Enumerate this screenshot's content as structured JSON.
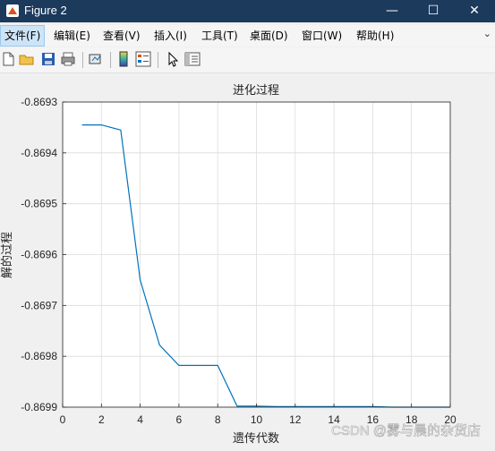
{
  "window": {
    "title": "Figure 2",
    "minimize": "—",
    "maximize": "☐",
    "close": "✕"
  },
  "menu": [
    "文件(F)",
    "编辑(E)",
    "查看(V)",
    "插入(I)",
    "工具(T)",
    "桌面(D)",
    "窗口(W)",
    "帮助(H)"
  ],
  "toolbar_icons": [
    "new-figure-icon",
    "open-file-icon",
    "save-icon",
    "print-icon",
    "link-plot-icon",
    "colorbar-icon",
    "legend-icon",
    "edit-plot-arrow-icon",
    "property-inspector-icon"
  ],
  "watermark": "CSDN @雾与晨的杂货店",
  "chart_data": {
    "type": "line",
    "title": "进化过程",
    "xlabel": "遗传代数",
    "ylabel": "解的过程",
    "xlim": [
      0,
      20
    ],
    "ylim": [
      -0.8699,
      -0.8693
    ],
    "xticks": [
      0,
      2,
      4,
      6,
      8,
      10,
      12,
      14,
      16,
      18,
      20
    ],
    "yticks": [
      -0.8693,
      -0.8694,
      -0.8695,
      -0.8696,
      -0.8697,
      -0.8698,
      -0.8699
    ],
    "ytick_labels": [
      "-0.8693",
      "-0.8694",
      "-0.8695",
      "-0.8696",
      "-0.8697",
      "-0.8698",
      "-0.8699"
    ],
    "grid": true,
    "line_color": "#0072bd",
    "series": [
      {
        "x": [
          1,
          2,
          3,
          4,
          5,
          6,
          7,
          8,
          9,
          10,
          11,
          12,
          13,
          14,
          15,
          16,
          17,
          18,
          19,
          20
        ],
        "values": [
          -0.869345,
          -0.869345,
          -0.869355,
          -0.86965,
          -0.869778,
          -0.869818,
          -0.869818,
          -0.869818,
          -0.869898,
          -0.869898,
          -0.869899,
          -0.869899,
          -0.869899,
          -0.869899,
          -0.869899,
          -0.869899,
          -0.8699,
          -0.8699,
          -0.8699,
          -0.8699
        ]
      }
    ]
  }
}
